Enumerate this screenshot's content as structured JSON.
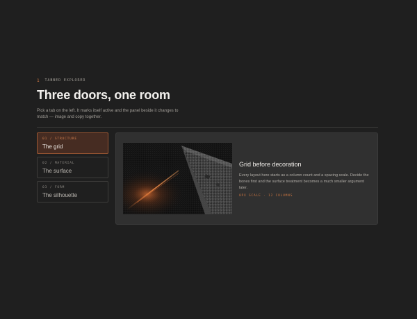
{
  "header": {
    "eyebrow_num": "1",
    "eyebrow_label": "TABBED EXPLORER",
    "title": "Three doors, one room",
    "description": "Pick a tab on the left. It marks itself active and the panel beside it changes to match — image and copy together."
  },
  "tabs": [
    {
      "kicker": "01 / STRUCTURE",
      "label": "The grid",
      "active": true
    },
    {
      "kicker": "02 / MATERIAL",
      "label": "The surface",
      "active": false
    },
    {
      "kicker": "03 / FORM",
      "label": "The silhouette",
      "active": false
    }
  ],
  "panel": {
    "image_icon": "architectural-concrete-photo",
    "title": "Grid before decoration",
    "body": "Every layout here starts as a column count and a spacing scale. Decide the bones first and the surface treatment becomes a much smaller argument later.",
    "meta": "8PX SCALE · 12 COLUMNS"
  },
  "colors": {
    "background": "#1f1f1f",
    "accent": "#d27a45",
    "active_tab_bg": "#462c22",
    "panel_bg": "#303030"
  }
}
